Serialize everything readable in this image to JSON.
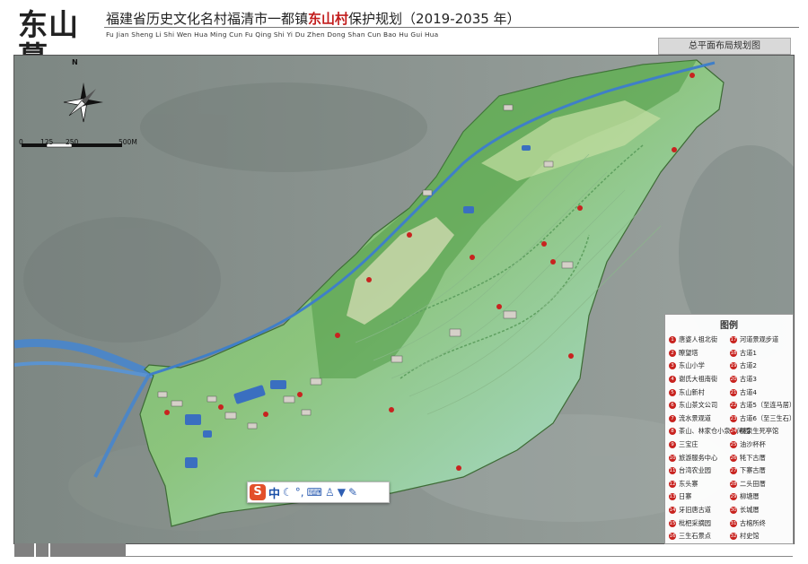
{
  "header": {
    "logo_text": "东山暮",
    "title_pre": "福建省历史文化名村福清市一都镇",
    "title_highlight": "东山村",
    "title_post": "保护规划（2019-2035 年）",
    "pinyin": "Fu Jian Sheng Li Shi Wen Hua Ming Cun Fu Qing Shi Yi Du Zhen Dong Shan Cun Bao Hu Gui Hua",
    "sheet_label": "总平面布局规划图"
  },
  "compass": {
    "north_label": "N"
  },
  "scale_bar": {
    "ticks": [
      "0",
      "125",
      "250",
      "500M"
    ]
  },
  "legend": {
    "title": "图例",
    "items": [
      {
        "n": "1",
        "label": "唐婆人祖北街"
      },
      {
        "n": "2",
        "label": "瞭望塔"
      },
      {
        "n": "3",
        "label": "东山小学"
      },
      {
        "n": "4",
        "label": "谢氏大祖南街"
      },
      {
        "n": "5",
        "label": "东山新村"
      },
      {
        "n": "6",
        "label": "东山茶文公司"
      },
      {
        "n": "7",
        "label": "流水景观道"
      },
      {
        "n": "8",
        "label": "茶山、林家仓小泉休闲园"
      },
      {
        "n": "9",
        "label": "三宝庄"
      },
      {
        "n": "10",
        "label": "旅游服务中心"
      },
      {
        "n": "11",
        "label": "台湾农业园"
      },
      {
        "n": "12",
        "label": "东头寨"
      },
      {
        "n": "13",
        "label": "日寨"
      },
      {
        "n": "14",
        "label": "牙旧唐古道"
      },
      {
        "n": "15",
        "label": "枇杷采摘园"
      },
      {
        "n": "16",
        "label": "三生石景点"
      },
      {
        "n": "17",
        "label": "河道景观步道"
      },
      {
        "n": "18",
        "label": "古道1"
      },
      {
        "n": "19",
        "label": "古道2"
      },
      {
        "n": "20",
        "label": "古道3"
      },
      {
        "n": "21",
        "label": "古道4"
      },
      {
        "n": "22",
        "label": "古道5（至连马居）"
      },
      {
        "n": "23",
        "label": "古道6（至三生石）"
      },
      {
        "n": "24",
        "label": "林泉生死亭馆"
      },
      {
        "n": "25",
        "label": "油沙杯杯"
      },
      {
        "n": "26",
        "label": "牦下古厝"
      },
      {
        "n": "27",
        "label": "下寨古厝"
      },
      {
        "n": "28",
        "label": "二头田厝"
      },
      {
        "n": "29",
        "label": "柳塘厝"
      },
      {
        "n": "30",
        "label": "长城厝"
      },
      {
        "n": "31",
        "label": "古榕所终"
      },
      {
        "n": "32",
        "label": "村史馆"
      }
    ]
  },
  "ime_toolbar": {
    "logo": "S",
    "mode": "中",
    "icons": [
      "moon-icon",
      "punctuation-icon",
      "keyboard-icon",
      "user-icon",
      "shirt-icon",
      "wrench-icon"
    ]
  },
  "colors": {
    "marker_red": "#c8231f",
    "river_blue": "#3d7fc4",
    "plan_green": "#6fb36a",
    "title_highlight": "#c21d1d"
  }
}
